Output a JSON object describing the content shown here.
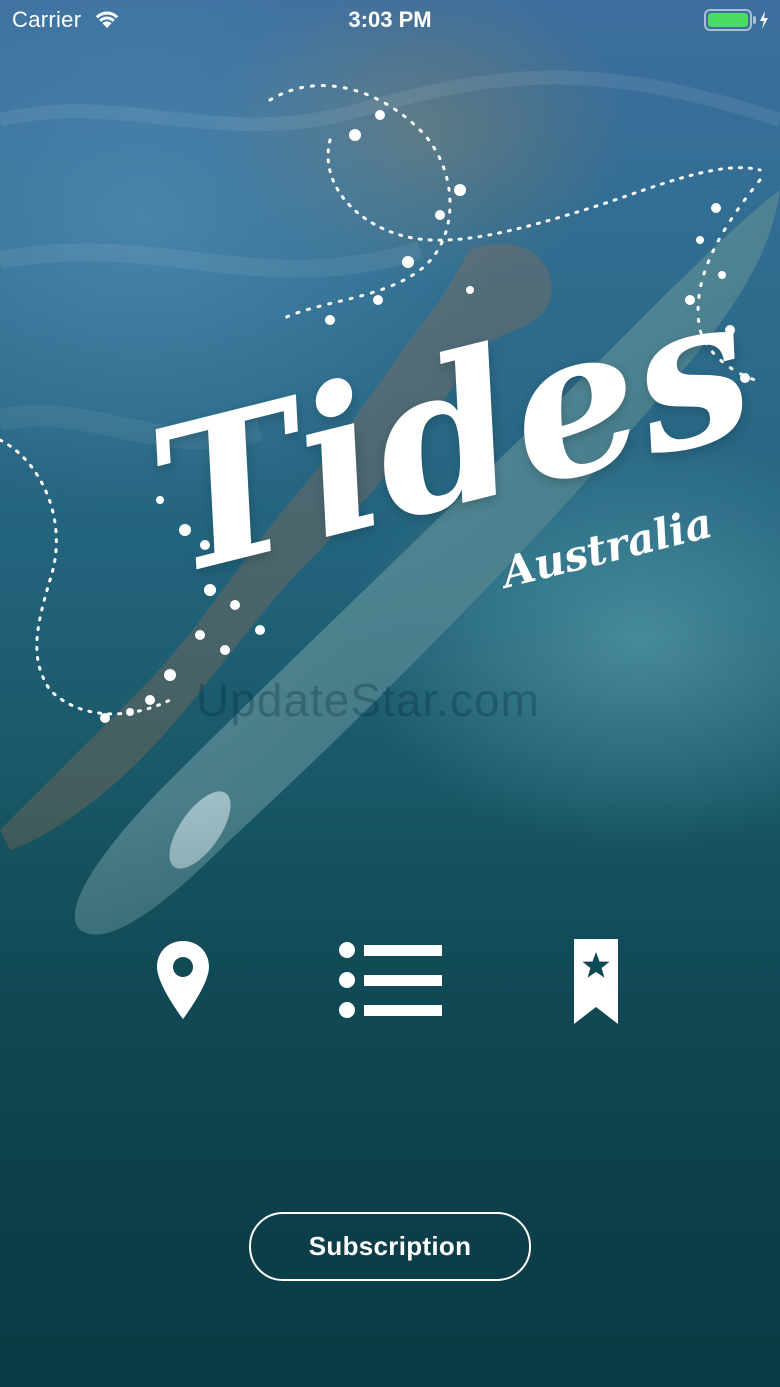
{
  "status_bar": {
    "carrier": "Carrier",
    "time": "3:03 PM",
    "battery_color": "#4cd964"
  },
  "logo": {
    "title": "Tides",
    "subtitle": "Australia"
  },
  "watermark": "UpdateStar.com",
  "nav": {
    "items": [
      {
        "icon": "map-pin-icon"
      },
      {
        "icon": "list-icon"
      },
      {
        "icon": "bookmark-star-icon"
      }
    ]
  },
  "subscription": {
    "label": "Subscription"
  }
}
